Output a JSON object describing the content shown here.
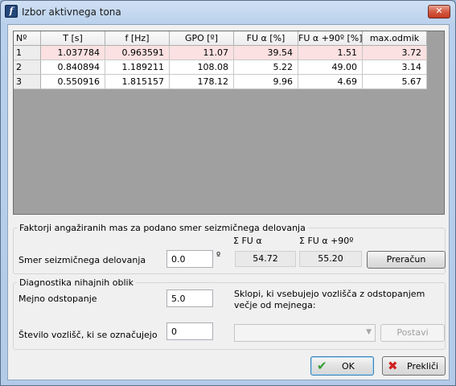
{
  "window": {
    "title": "Izbor aktivnega tona",
    "close_glyph": "✕",
    "app_icon_glyph": "f"
  },
  "table": {
    "headers": [
      "Nº",
      "T [s]",
      "f [Hz]",
      "GPO [º]",
      "FU α [%]",
      "FU α +90º [%]",
      "max.odmik"
    ],
    "rows": [
      [
        "1",
        "1.037784",
        "0.963591",
        "11.07",
        "39.54",
        "1.51",
        "3.72"
      ],
      [
        "2",
        "0.840894",
        "1.189211",
        "108.08",
        "5.22",
        "49.00",
        "3.14"
      ],
      [
        "3",
        "0.550916",
        "1.815157",
        "178.12",
        "9.96",
        "4.69",
        "5.67"
      ]
    ],
    "selected_row": 0
  },
  "factors": {
    "title": "Faktorji angažiranih mas za podano smer seizmičnega delovanja",
    "sum_fu_label": "Σ FU α",
    "sum_fu90_label": "Σ FU α +90º",
    "direction_label": "Smer seizmičnega delovanja",
    "direction_value": "0.0",
    "degree_symbol": "º",
    "sum_fu_value": "54.72",
    "sum_fu90_value": "55.20",
    "recalc_label": "Preračun"
  },
  "diagnostics": {
    "title": "Diagnostika nihajnih oblik",
    "limit_label": "Mejno odstopanje",
    "limit_value": "5.0",
    "groups_label": "Sklopi, ki vsebujejo vozlišča z odstopanjem večje od mejnega:",
    "node_count_label": "Število vozlišč, ki se označujejo",
    "node_count_value": "0",
    "combo_value": "",
    "apply_label": "Postavi"
  },
  "buttons": {
    "ok_label": "OK",
    "cancel_label": "Prekliči"
  },
  "colors": {
    "selected_row_bg": "#fbe1e1",
    "ok_check": "#2e9b2e",
    "cancel_x": "#d02020"
  }
}
